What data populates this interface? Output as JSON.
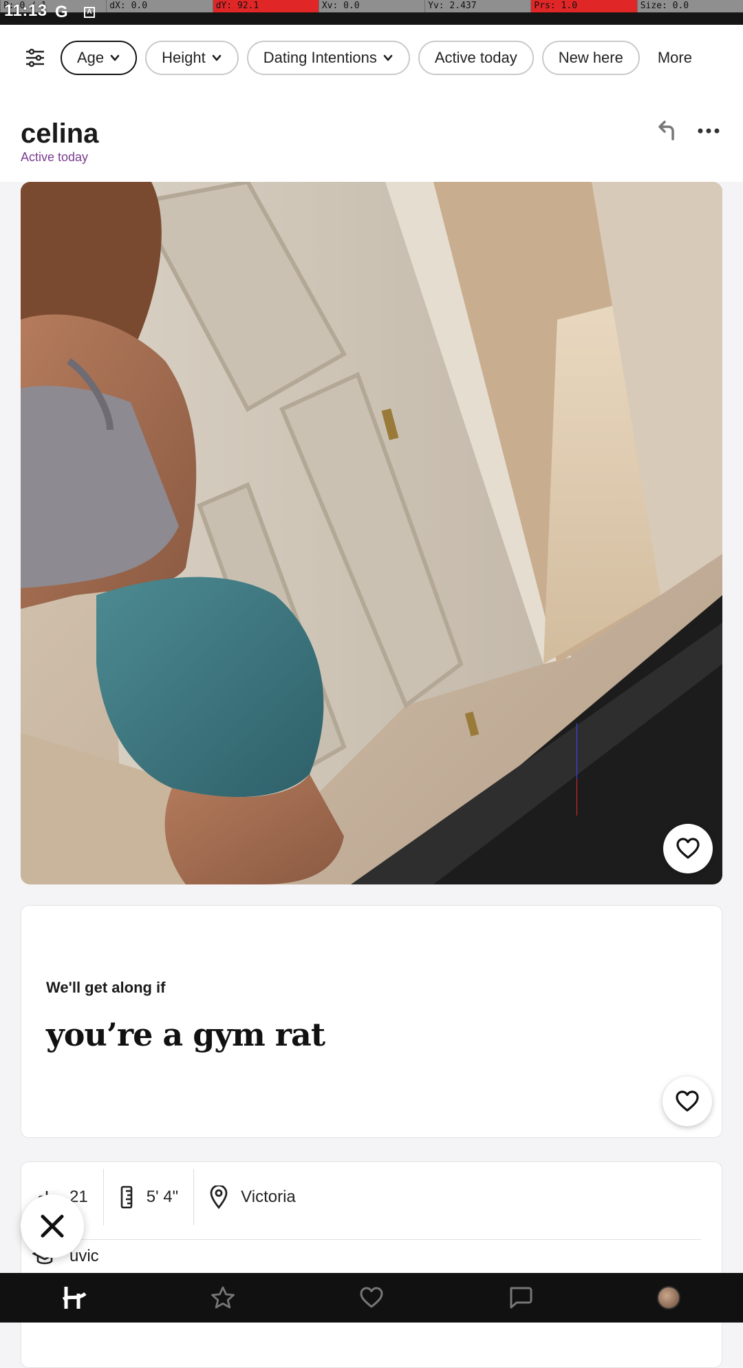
{
  "debug": {
    "cells": [
      {
        "label": "P: 0 / 1",
        "alert": false
      },
      {
        "label": "dX: 0.0",
        "alert": false
      },
      {
        "label": "dY: 92.1",
        "alert": true
      },
      {
        "label": "Xv: 0.0",
        "alert": false
      },
      {
        "label": "Yv: 2.437",
        "alert": false
      },
      {
        "label": "Prs: 1.0",
        "alert": true
      },
      {
        "label": "Size: 0.0",
        "alert": false
      }
    ]
  },
  "status": {
    "time": "11:13",
    "g_icon": "G",
    "a_icon": "A"
  },
  "filters": {
    "icon": "sliders-icon",
    "chips": [
      {
        "label": "Age",
        "has_chevron": true,
        "selected": true
      },
      {
        "label": "Height",
        "has_chevron": true,
        "selected": false
      },
      {
        "label": "Dating Intentions",
        "has_chevron": true,
        "selected": false
      },
      {
        "label": "Active today",
        "has_chevron": false,
        "selected": false
      },
      {
        "label": "New here",
        "has_chevron": false,
        "selected": false
      }
    ],
    "more_label": "More"
  },
  "profile": {
    "name": "celina",
    "activity": "Active today",
    "actions": [
      "undo-icon",
      "more-icon"
    ]
  },
  "photo": {
    "description_icon": "heart-icon"
  },
  "prompt": {
    "label": "We'll get along if",
    "answer": "you’re a gym rat"
  },
  "info": {
    "age_partial": "21",
    "height": "5' 4\"",
    "location": "Victoria",
    "school": "uvic"
  },
  "nav": {
    "items": [
      "hinge-logo-icon",
      "star-icon",
      "heart-icon",
      "chat-icon",
      "avatar"
    ]
  },
  "colors": {
    "accent_purple": "#7a3b8e",
    "nav_bg": "#111111",
    "debug_alert": "#e02626"
  }
}
